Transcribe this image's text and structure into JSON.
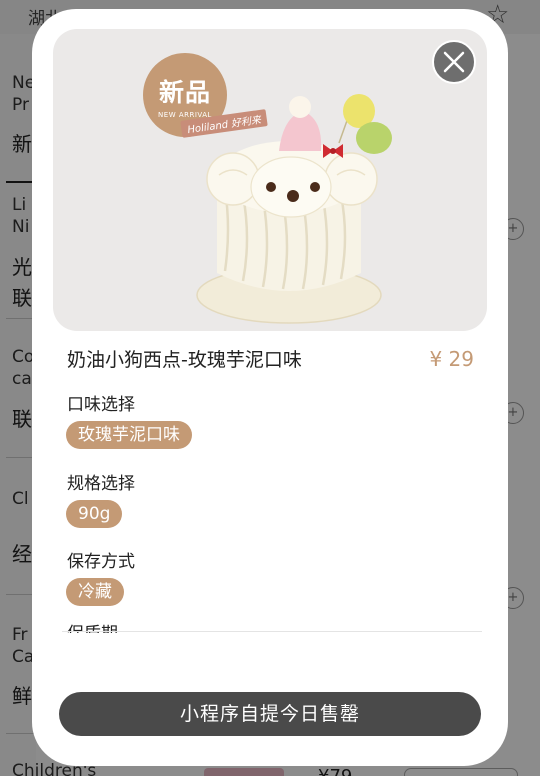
{
  "background": {
    "top_text": "湖北省武汉市江汉区新华路",
    "categories": [
      {
        "en": [
          "Ne",
          "Pr"
        ],
        "cn": "新"
      },
      {
        "en": [
          "Li",
          "Ni"
        ],
        "cn": [
          "光",
          "联"
        ]
      },
      {
        "en": [
          "Co",
          "ca"
        ],
        "cn": "联"
      },
      {
        "en": [
          "Cl"
        ],
        "cn": "经"
      },
      {
        "en": [
          "Fr",
          "Ca"
        ],
        "cn": "鲜"
      },
      {
        "en": [
          "Children's"
        ],
        "cn": ""
      }
    ],
    "bottom_price": "¥79",
    "add_icon_label": "+"
  },
  "modal": {
    "badge": {
      "main": "新品",
      "sub": "NEW ARRIVAL"
    },
    "brand_tag": "Holiland 好利来",
    "product_name": "奶油小狗西点-玫瑰芋泥口味",
    "price": "¥ 29",
    "options": [
      {
        "label": "口味选择",
        "value": "玫瑰芋泥口味"
      },
      {
        "label": "规格选择",
        "value": "90g"
      },
      {
        "label": "保存方式",
        "value": "冷藏"
      }
    ],
    "partial_label": "保质期",
    "cta": "小程序自提今日售罄"
  },
  "colors": {
    "accent": "#c49a75",
    "cta_bg": "#4a4a4a",
    "hero_bg": "#ebe9e8",
    "overlay": "rgba(0,0,0,0.45)"
  },
  "icons": {
    "close": "close-icon",
    "favorite": "star-icon",
    "add": "plus-circle-icon"
  }
}
